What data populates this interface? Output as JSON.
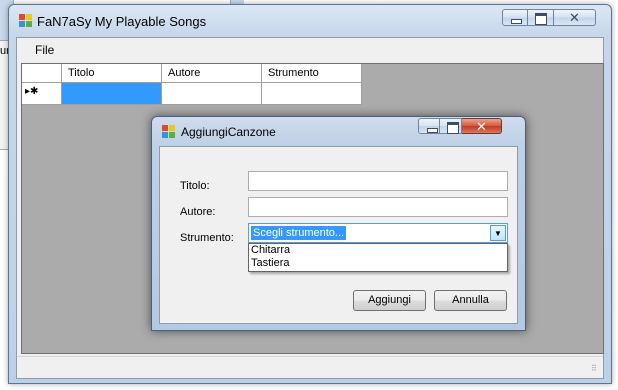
{
  "background": {
    "partial_text": "um"
  },
  "main_window": {
    "title": "FaN7aSy My Playable Songs",
    "menu": {
      "file_label": "File"
    },
    "grid": {
      "columns": [
        "Titolo",
        "Autore",
        "Strumento"
      ],
      "new_row_marker": "▸✱"
    },
    "caption": {
      "close_glyph": "✕"
    }
  },
  "dialog": {
    "title": "AggiungiCanzone",
    "labels": {
      "titolo": "Titolo:",
      "autore": "Autore:",
      "strumento": "Strumento:"
    },
    "fields": {
      "titolo_value": "",
      "autore_value": ""
    },
    "combo": {
      "selected": "Scegli strumento...",
      "options": [
        "Chitarra",
        "Tastiera"
      ],
      "arrow": "▼"
    },
    "buttons": {
      "add": "Aggiungi",
      "cancel": "Annulla"
    },
    "caption": {
      "close_glyph": "✕"
    }
  },
  "colors": {
    "selection": "#3399ff",
    "grid_background": "#ababab",
    "close_button": "#c7381e"
  },
  "icons": [
    "app-icon",
    "minimize-icon",
    "maximize-icon",
    "close-icon",
    "dropdown-arrow-icon",
    "new-row-icon",
    "size-grip-icon"
  ]
}
